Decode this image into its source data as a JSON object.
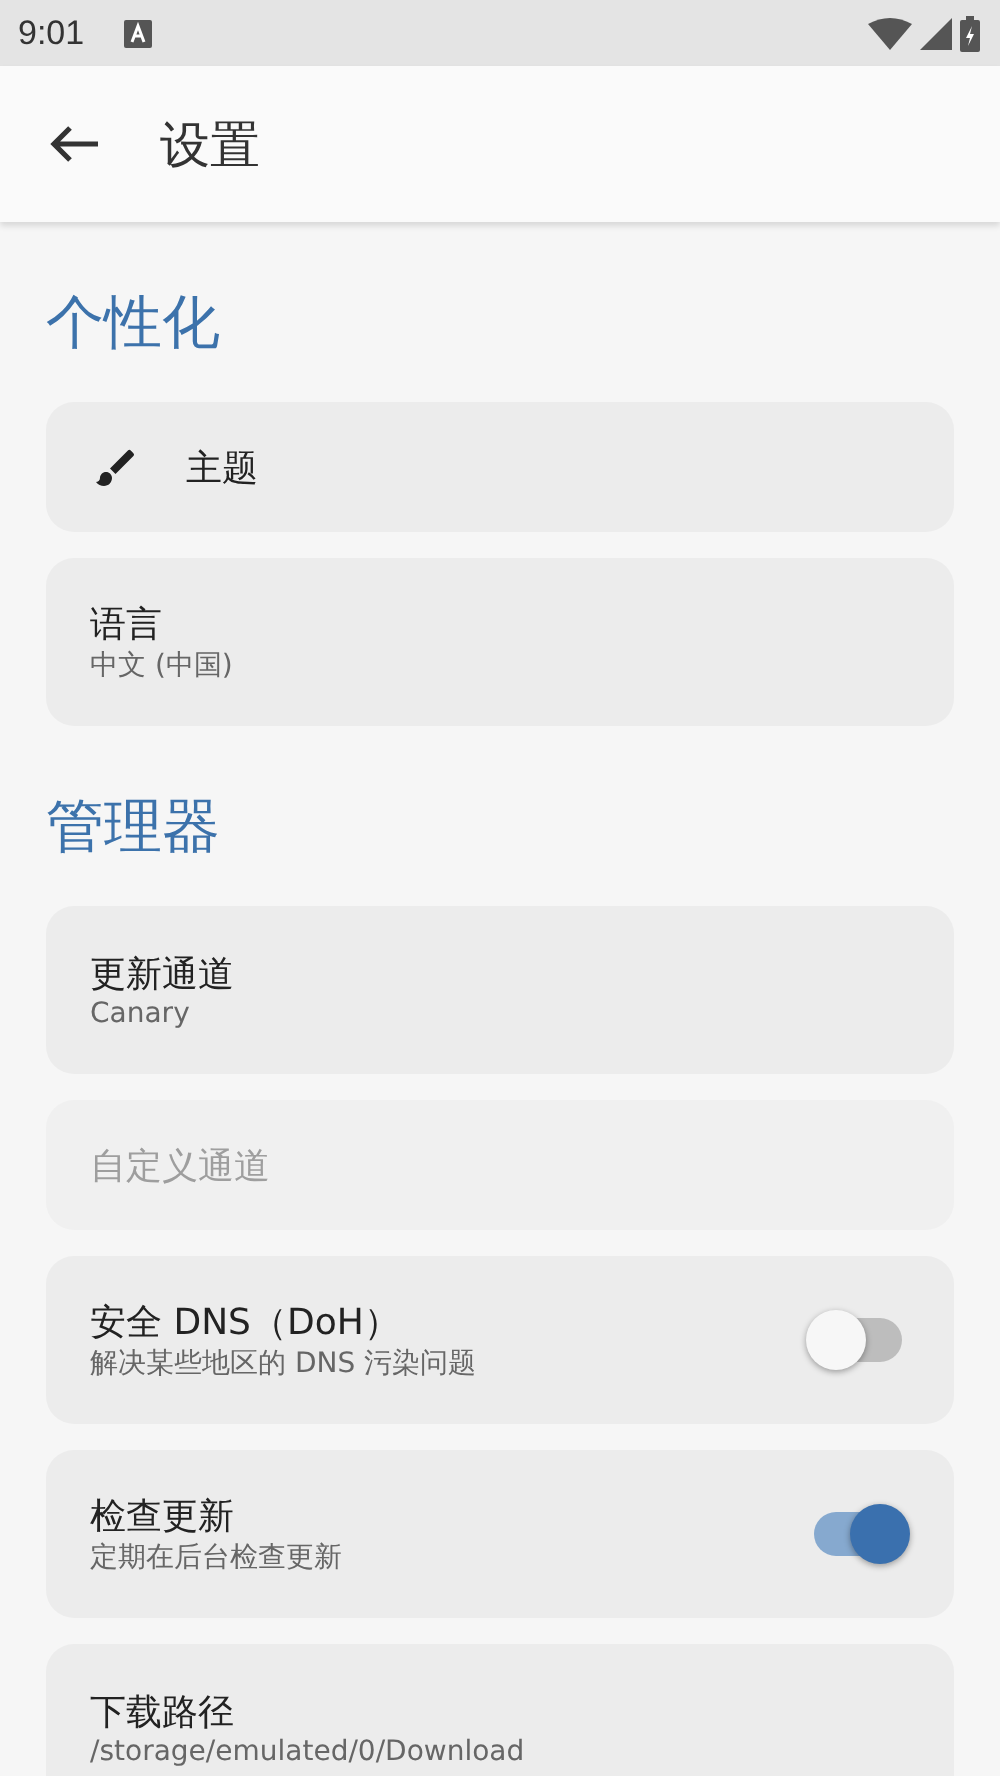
{
  "status_bar": {
    "time": "9:01"
  },
  "app_bar": {
    "title": "设置"
  },
  "sections": [
    {
      "title": "个性化",
      "items": [
        {
          "kind": "icon",
          "title": "主题",
          "disabled": false
        },
        {
          "kind": "text",
          "title": "语言",
          "subtitle": "中文 (中国)",
          "disabled": false
        }
      ]
    },
    {
      "title": "管理器",
      "items": [
        {
          "kind": "text",
          "title": "更新通道",
          "subtitle": "Canary",
          "disabled": false
        },
        {
          "kind": "text",
          "title": "自定义通道",
          "disabled": true
        },
        {
          "kind": "switch",
          "title": "安全 DNS（DoH）",
          "subtitle": "解决某些地区的 DNS 污染问题",
          "on": false,
          "disabled": false
        },
        {
          "kind": "switch",
          "title": "检查更新",
          "subtitle": "定期在后台检查更新",
          "on": true,
          "disabled": false
        },
        {
          "kind": "text",
          "title": "下载路径",
          "subtitle": "/storage/emulated/0/Download",
          "disabled": false
        }
      ]
    }
  ]
}
